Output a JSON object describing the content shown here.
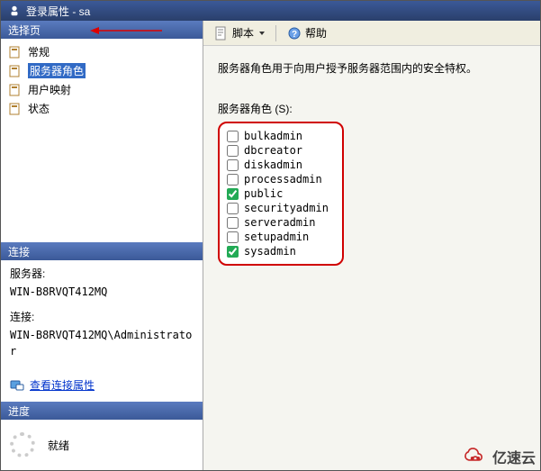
{
  "title": "登录属性 - sa",
  "left": {
    "select_header": "选择页",
    "nav": [
      {
        "label": "常规",
        "selected": false
      },
      {
        "label": "服务器角色",
        "selected": true
      },
      {
        "label": "用户映射",
        "selected": false
      },
      {
        "label": "状态",
        "selected": false
      }
    ],
    "conn_header": "连接",
    "server_label": "服务器:",
    "server_value": "WIN-B8RVQT412MQ",
    "conn_label": "连接:",
    "conn_value": "WIN-B8RVQT412MQ\\Administrator",
    "view_conn_link": "查看连接属性",
    "progress_header": "进度",
    "ready_label": "就绪"
  },
  "toolbar": {
    "script_label": "脚本",
    "help_label": "帮助"
  },
  "content": {
    "description": "服务器角色用于向用户授予服务器范围内的安全特权。",
    "roles_label": "服务器角色 (S):",
    "roles": [
      {
        "name": "bulkadmin",
        "checked": false
      },
      {
        "name": "dbcreator",
        "checked": false
      },
      {
        "name": "diskadmin",
        "checked": false
      },
      {
        "name": "processadmin",
        "checked": false
      },
      {
        "name": "public",
        "checked": true
      },
      {
        "name": "securityadmin",
        "checked": false
      },
      {
        "name": "serveradmin",
        "checked": false
      },
      {
        "name": "setupadmin",
        "checked": false
      },
      {
        "name": "sysadmin",
        "checked": true
      }
    ]
  },
  "watermark": "亿速云"
}
